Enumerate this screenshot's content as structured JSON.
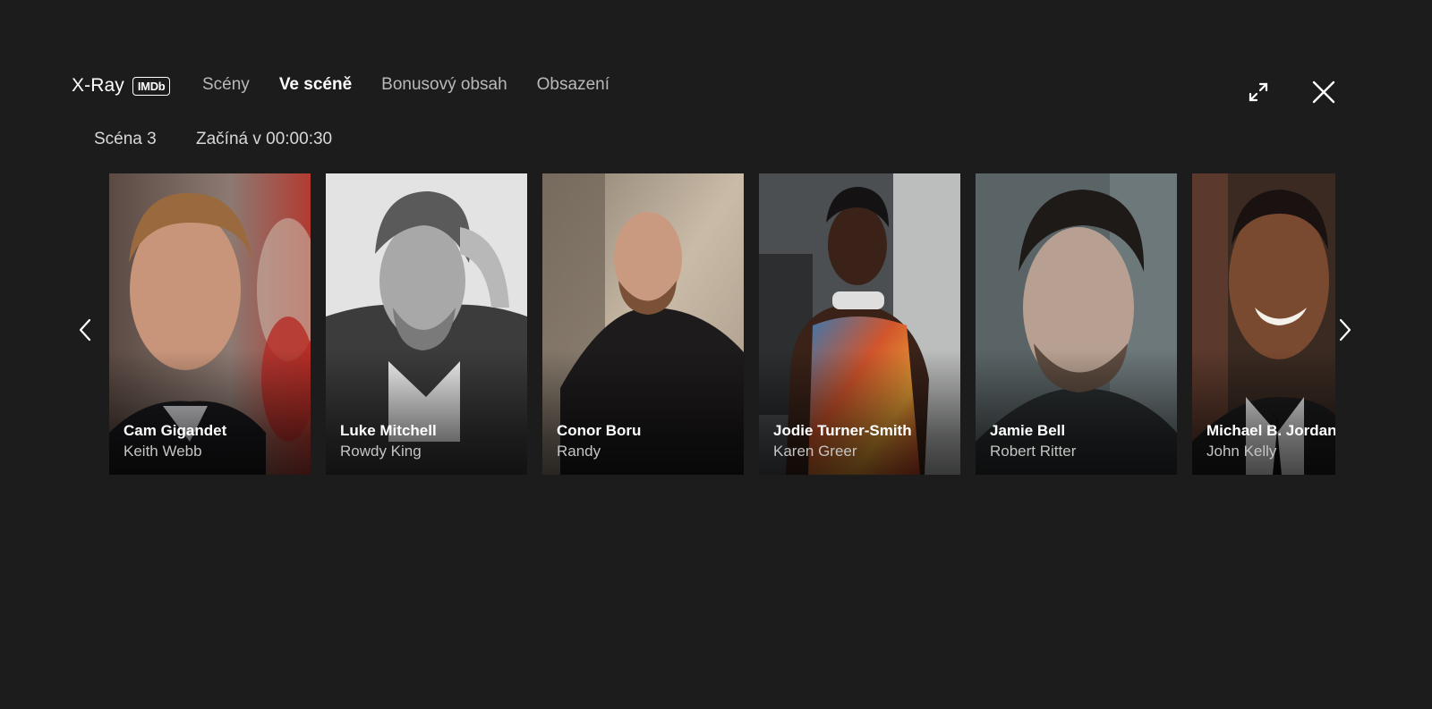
{
  "header": {
    "title": "X-Ray",
    "badge": "IMDb",
    "tabs": [
      {
        "label": "Scény",
        "active": false
      },
      {
        "label": "Ve scéně",
        "active": true
      },
      {
        "label": "Bonusový obsah",
        "active": false
      },
      {
        "label": "Obsazení",
        "active": false
      }
    ],
    "expand_icon": "expand-icon",
    "close_icon": "close-icon"
  },
  "scene": {
    "number_label": "Scéna 3",
    "start_label": "Začíná v 00:00:30"
  },
  "cast": [
    {
      "actor": "Cam Gigandet",
      "role": "Keith Webb"
    },
    {
      "actor": "Luke Mitchell",
      "role": "Rowdy King"
    },
    {
      "actor": "Conor Boru",
      "role": "Randy"
    },
    {
      "actor": "Jodie Turner-Smith",
      "role": "Karen Greer"
    },
    {
      "actor": "Jamie Bell",
      "role": "Robert Ritter"
    },
    {
      "actor": "Michael B. Jordan",
      "role": "John Kelly"
    }
  ],
  "navigation": {
    "prev_icon": "chevron-left-icon",
    "next_icon": "chevron-right-icon"
  },
  "colors": {
    "background": "#1c1c1d",
    "text_primary": "#ffffff",
    "text_secondary": "#b9b9b9"
  }
}
